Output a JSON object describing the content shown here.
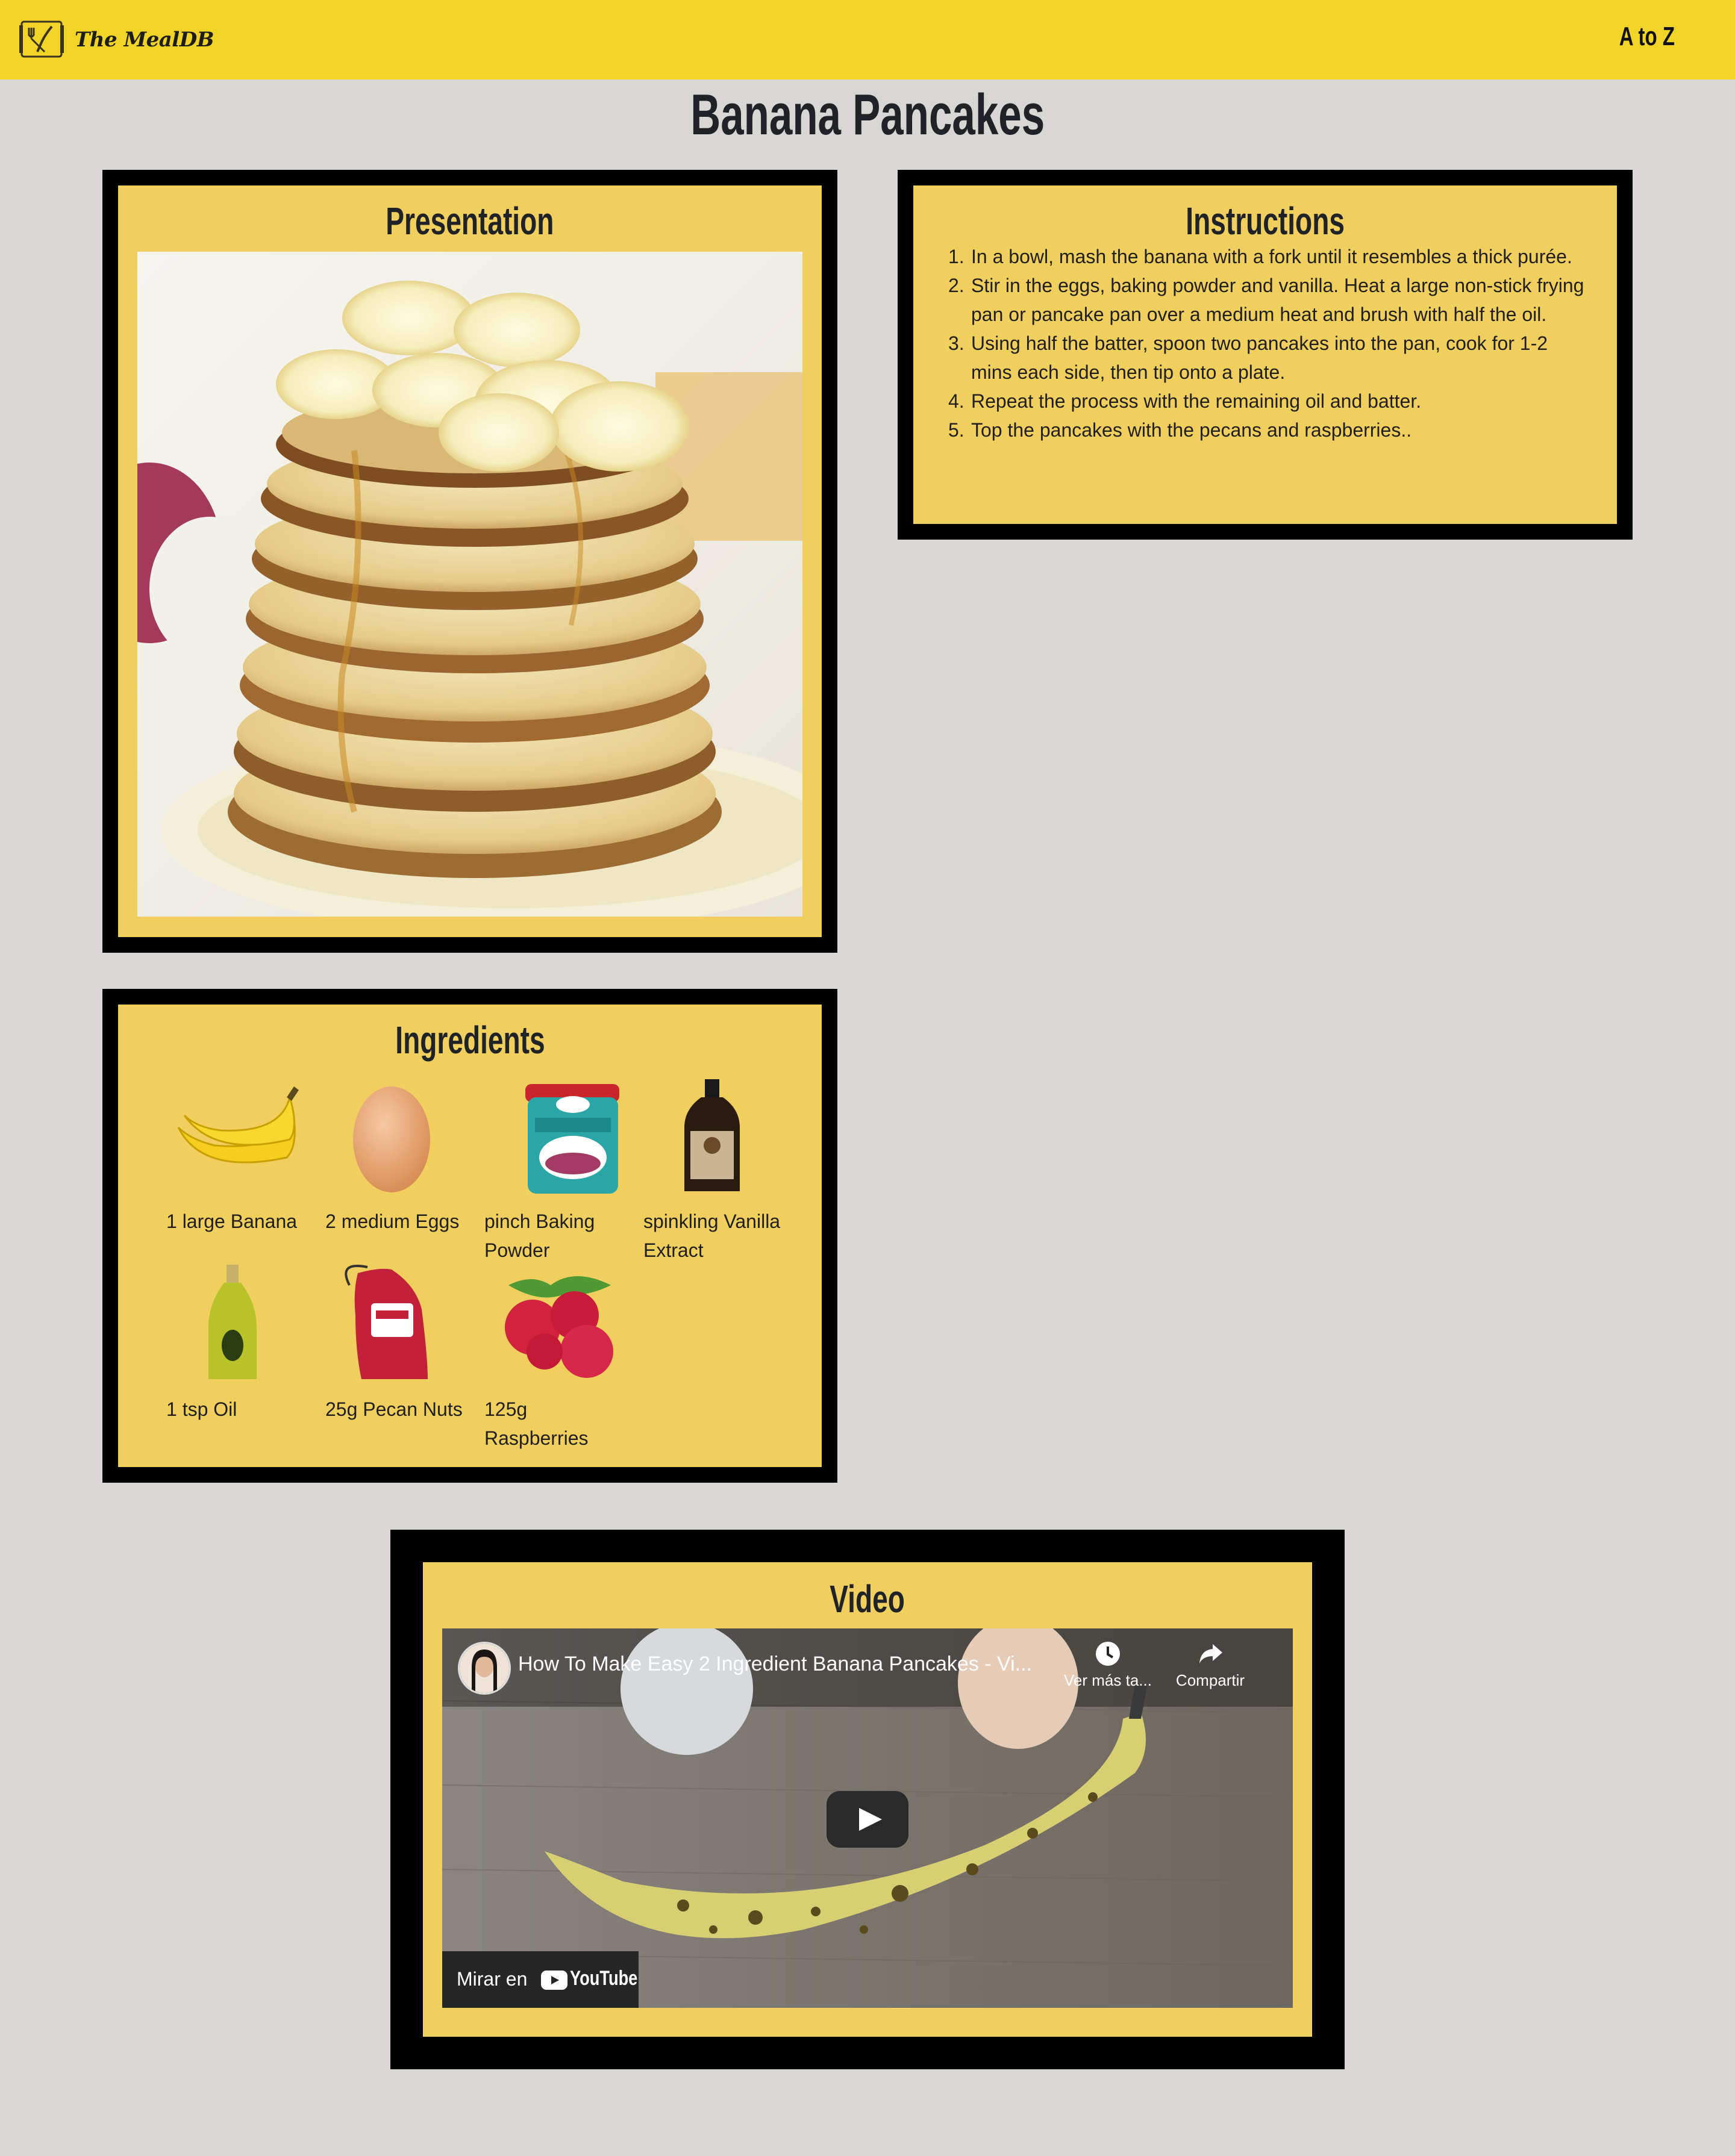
{
  "header": {
    "logo_text": "The MealDB",
    "nav_atoz": "A to Z",
    "colors": {
      "bar": "#f2d427"
    }
  },
  "page_title": "Banana Pancakes",
  "presentation": {
    "title": "Presentation",
    "image": "banana-pancakes-stack-photo"
  },
  "instructions": {
    "title": "Instructions",
    "steps": [
      "In a bowl, mash the banana with a fork until it resembles a thick purée.",
      "Stir in the eggs, baking powder and vanilla. Heat a large non-stick frying pan or pancake pan over a medium heat and brush with half the oil.",
      "Using half the batter, spoon two pancakes into the pan, cook for 1-2 mins each side, then tip onto a plate.",
      "Repeat the process with the remaining oil and batter.",
      "Top the pancakes with the pecans and raspberries.."
    ]
  },
  "ingredients": {
    "title": "Ingredients",
    "items": [
      {
        "label": "1 large Banana",
        "icon": "banana"
      },
      {
        "label": "2 medium Eggs",
        "icon": "egg"
      },
      {
        "label": "pinch Baking Powder",
        "icon": "baking-powder-tin"
      },
      {
        "label": "spinkling Vanilla Extract",
        "icon": "vanilla-bottle"
      },
      {
        "label": "1 tsp Oil",
        "icon": "oil-bottle"
      },
      {
        "label": "25g Pecan Nuts",
        "icon": "pecan-bag"
      },
      {
        "label": "125g Raspberries",
        "icon": "raspberries"
      }
    ]
  },
  "video": {
    "title": "Video",
    "video_title": "How To Make Easy 2 Ingredient Banana Pancakes - Vi...",
    "watch_later": "Ver más ta...",
    "share": "Compartir",
    "watch_on": "Mirar en",
    "youtube": "YouTube"
  },
  "colors": {
    "card_bg": "#f0cf5e",
    "page_bg": "#d8d7d3",
    "frame": "#000000"
  }
}
